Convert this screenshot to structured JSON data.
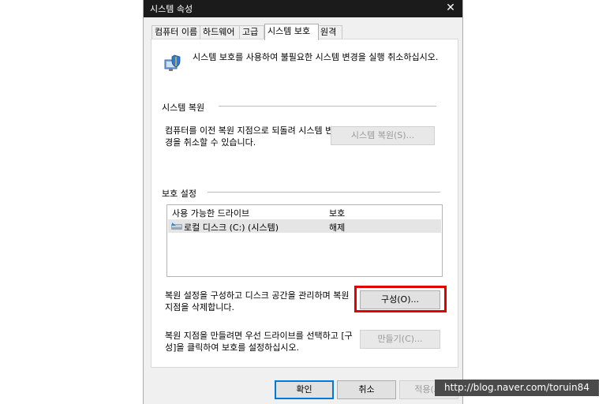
{
  "window": {
    "title": "시스템 속성",
    "close": "✕"
  },
  "tabs": [
    "컴퓨터 이름",
    "하드웨어",
    "고급",
    "시스템 보호",
    "원격"
  ],
  "intro": "시스템 보호를 사용하여 불필요한 시스템 변경을 실행 취소하십시오.",
  "restore": {
    "group": "시스템 복원",
    "desc": "컴퓨터를 이전 복원 지점으로 되돌려 시스템 변경을 취소할 수 있습니다.",
    "button": "시스템 복원(S)..."
  },
  "protection": {
    "group": "보호 설정",
    "columns": {
      "drive": "사용 가능한 드라이브",
      "protect": "보호"
    },
    "rows": [
      {
        "name": "로컬 디스크 (C:) (시스템)",
        "protect": "해제"
      }
    ],
    "configure_desc": "복원 설정을 구성하고 디스크 공간을 관리하며 복원 지점을 삭제합니다.",
    "configure_button": "구성(O)...",
    "create_desc": "복원 지점을 만들려면 우선 드라이브를 선택하고 [구성]을 클릭하여 보호를 설정하십시오.",
    "create_button": "만들기(C)..."
  },
  "footer": {
    "ok": "확인",
    "cancel": "취소",
    "apply": "적용(A)"
  },
  "watermark": "http://blog.naver.com/toruin84",
  "icons": {
    "close": "close-icon",
    "shield": "shield-icon",
    "drive": "drive-icon"
  },
  "colors": {
    "highlight": "#e50000",
    "titlebar": "#1b1b1b",
    "accent": "#0078d7"
  }
}
